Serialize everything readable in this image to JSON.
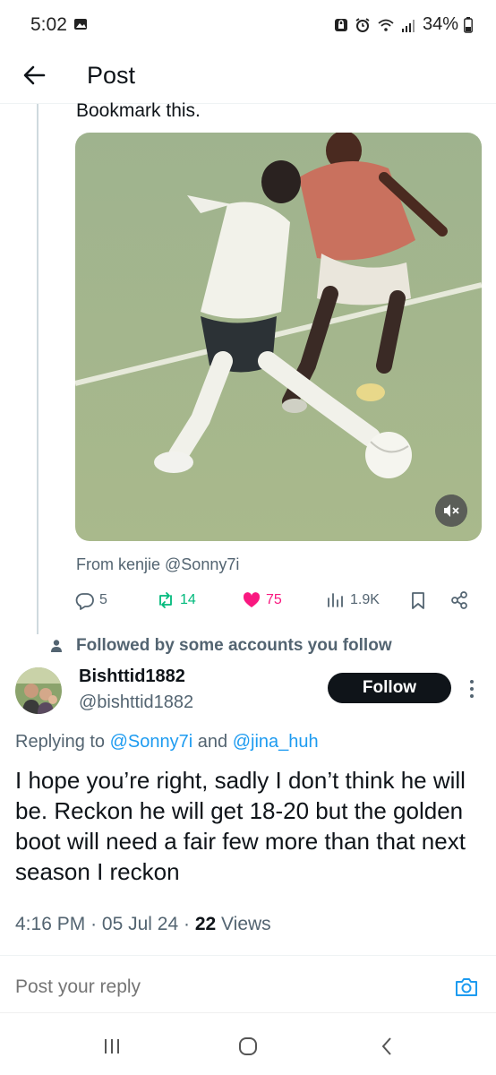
{
  "status_bar": {
    "time": "5:02",
    "battery": "34%",
    "icons": [
      "image-icon",
      "lock-icon",
      "alarm-icon",
      "wifi-icon",
      "signal-icon",
      "battery-icon"
    ]
  },
  "header": {
    "title": "Post",
    "back_icon": "arrow-left-icon"
  },
  "quoted_post": {
    "text": "Bookmark this.",
    "from_line": "From kenjie @Sonny7i",
    "actions": {
      "replies": "5",
      "reposts": "14",
      "likes": "75",
      "views": "1.9K"
    }
  },
  "followed_notice": "Followed by some accounts you follow",
  "reply_post": {
    "author_name": "Bishttid1882",
    "author_handle": "@bishttid1882",
    "follow_label": "Follow",
    "replying_prefix": "Replying to",
    "mention_1": "@Sonny7i",
    "and_word": "and",
    "mention_2": "@jina_huh",
    "body": "I hope you’re right, sadly I don’t think he will be. Reckon he will get 18-20 but the golden boot will need a fair few more than that next season I reckon",
    "time": "4:16 PM",
    "date": "05 Jul 24",
    "views_count": "22",
    "views_label": "Views"
  },
  "reply_box": {
    "placeholder": "Post your reply"
  },
  "colors": {
    "accent": "#1d9bf0",
    "like": "#f91880",
    "repost": "#00ba7c",
    "muted": "#536471"
  }
}
